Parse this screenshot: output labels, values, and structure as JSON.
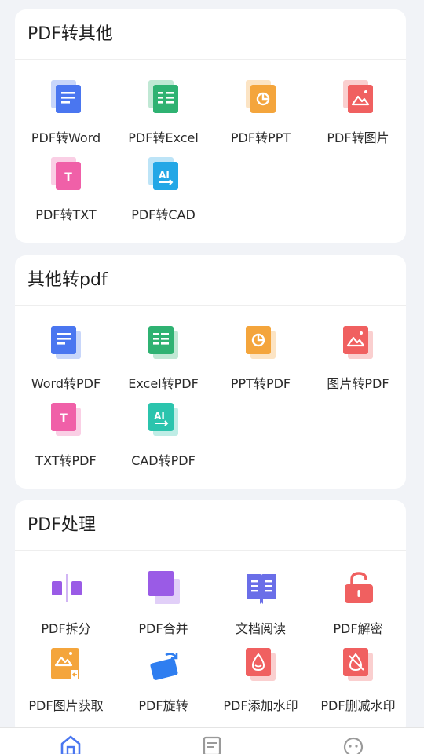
{
  "sections": [
    {
      "title": "PDF转其他",
      "items": [
        {
          "label": "PDF转Word",
          "icon": "word-doc-icon"
        },
        {
          "label": "PDF转Excel",
          "icon": "excel-sheet-icon"
        },
        {
          "label": "PDF转PPT",
          "icon": "ppt-chart-icon"
        },
        {
          "label": "PDF转图片",
          "icon": "image-icon"
        },
        {
          "label": "PDF转TXT",
          "icon": "txt-icon"
        },
        {
          "label": "PDF转CAD",
          "icon": "cad-icon"
        }
      ]
    },
    {
      "title": "其他转pdf",
      "items": [
        {
          "label": "Word转PDF",
          "icon": "word-doc-icon"
        },
        {
          "label": "Excel转PDF",
          "icon": "excel-sheet-icon"
        },
        {
          "label": "PPT转PDF",
          "icon": "ppt-chart-icon"
        },
        {
          "label": "图片转PDF",
          "icon": "image-icon"
        },
        {
          "label": "TXT转PDF",
          "icon": "txt-icon"
        },
        {
          "label": "CAD转PDF",
          "icon": "cad-icon"
        }
      ]
    },
    {
      "title": "PDF处理",
      "items": [
        {
          "label": "PDF拆分",
          "icon": "split-icon"
        },
        {
          "label": "PDF合并",
          "icon": "merge-icon"
        },
        {
          "label": "文档阅读",
          "icon": "book-icon"
        },
        {
          "label": "PDF解密",
          "icon": "unlock-icon"
        },
        {
          "label": "PDF图片获取",
          "icon": "image-extract-icon"
        },
        {
          "label": "PDF旋转",
          "icon": "rotate-icon"
        },
        {
          "label": "PDF添加水印",
          "icon": "add-watermark-icon"
        },
        {
          "label": "PDF删减水印",
          "icon": "remove-watermark-icon"
        }
      ]
    }
  ],
  "bottom_nav": [
    {
      "icon": "home-icon",
      "active": true
    },
    {
      "icon": "document-list-icon",
      "active": false
    },
    {
      "icon": "profile-icon",
      "active": false
    }
  ],
  "colors": {
    "word": "#4a76f0",
    "excel": "#2fb272",
    "ppt": "#f4a53c",
    "image": "#f06060",
    "txt": "#f060a8",
    "cad": "#23a7e6",
    "cad2": "#2bc4ad",
    "purple": "#9a5be6",
    "book": "#6a6ee8",
    "accent": "#4a76f0"
  }
}
